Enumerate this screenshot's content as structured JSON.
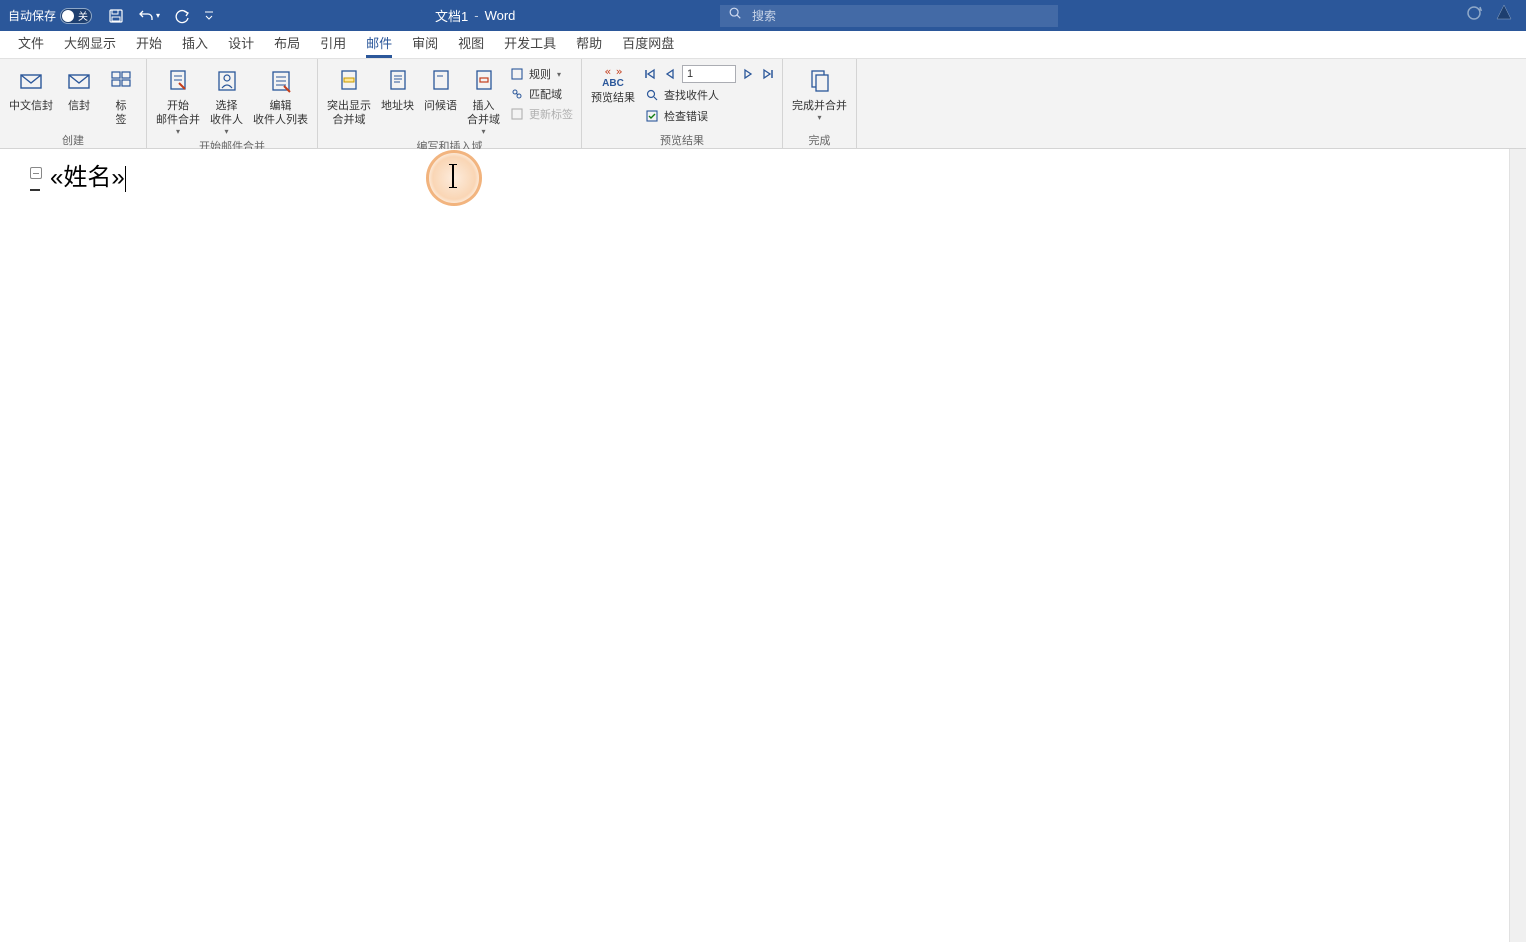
{
  "titlebar": {
    "autosave_label": "自动保存",
    "autosave_state": "关",
    "doc_name": "文档1",
    "app_name": "Word",
    "search_placeholder": "搜索"
  },
  "tabs": [
    {
      "label": "文件",
      "active": false,
      "name": "tab-file"
    },
    {
      "label": "大纲显示",
      "active": false,
      "name": "tab-outline"
    },
    {
      "label": "开始",
      "active": false,
      "name": "tab-home"
    },
    {
      "label": "插入",
      "active": false,
      "name": "tab-insert"
    },
    {
      "label": "设计",
      "active": false,
      "name": "tab-design"
    },
    {
      "label": "布局",
      "active": false,
      "name": "tab-layout"
    },
    {
      "label": "引用",
      "active": false,
      "name": "tab-references"
    },
    {
      "label": "邮件",
      "active": true,
      "name": "tab-mailings"
    },
    {
      "label": "审阅",
      "active": false,
      "name": "tab-review"
    },
    {
      "label": "视图",
      "active": false,
      "name": "tab-view"
    },
    {
      "label": "开发工具",
      "active": false,
      "name": "tab-developer"
    },
    {
      "label": "帮助",
      "active": false,
      "name": "tab-help"
    },
    {
      "label": "百度网盘",
      "active": false,
      "name": "tab-baidu"
    }
  ],
  "ribbon": {
    "groups": {
      "create": {
        "label": "创建",
        "envelope_cn": "中文信封",
        "envelope": "信封",
        "labels": "标\n签"
      },
      "start_merge": {
        "label": "开始邮件合并",
        "start": "开始\n邮件合并",
        "select": "选择\n收件人",
        "edit": "编辑\n收件人列表"
      },
      "write_insert": {
        "label": "编写和插入域",
        "highlight": "突出显示\n合并域",
        "address": "地址块",
        "greeting": "问候语",
        "insert": "插入\n合并域",
        "rules": "规则",
        "match": "匹配域",
        "update": "更新标签"
      },
      "preview": {
        "label": "预览结果",
        "preview": "预览结果",
        "record": "1",
        "find": "查找收件人",
        "check": "检查错误"
      },
      "finish": {
        "label": "完成",
        "finish": "完成并合并"
      }
    }
  },
  "document": {
    "field_text": "«姓名»"
  },
  "colors": {
    "brand": "#2b579a",
    "accent_orange": "#f0aa6e"
  }
}
